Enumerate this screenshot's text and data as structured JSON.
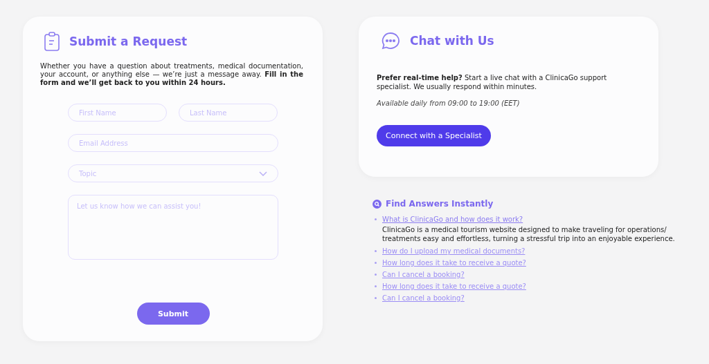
{
  "request": {
    "title": "Submit a Request",
    "intro": "Whether you have a question about treatments, medical documentation, your account, or anything else — we’re just a message away. **Fill in the form and we’ll get back to you within 24 hours.**",
    "fields": [
      {
        "kind": "text",
        "placeholder": "First Name"
      },
      {
        "kind": "text",
        "placeholder": "Last Name"
      },
      {
        "kind": "text",
        "placeholder": "Email Address"
      },
      {
        "kind": "select",
        "placeholder": "Topic"
      },
      {
        "kind": "textarea",
        "placeholder": "Let us know how we can assist you!"
      }
    ],
    "submit": "Submit"
  },
  "chat": {
    "title": "Chat with Us",
    "text": "**Prefer real-time help?** Start a live chat with a ClinicaGo support specialist. We usually respond within minutes.",
    "hours": "Available daily from 09:00 to 19:00 (EET)",
    "button": "Connect with a Specialist"
  },
  "faq": {
    "title": "Find Answers Instantly",
    "items": [
      {
        "question": "What is ClinicaGo and how does it work?",
        "expanded": true,
        "answer": "ClinicaGo is a medical tourism website designed to make traveling for operations/ treatments easy and effortless, turning a stressful trip into an enjoyable experience."
      },
      {
        "question": "How do I upload my medical documents?",
        "expanded": false
      },
      {
        "question": "How long does it take to receive a quote?",
        "expanded": false
      },
      {
        "question": "Can I cancel a booking?",
        "expanded": false
      },
      {
        "question": "How long does it take to receive a quote?",
        "expanded": false
      },
      {
        "question": "Can I cancel a booking?",
        "expanded": false
      }
    ]
  }
}
